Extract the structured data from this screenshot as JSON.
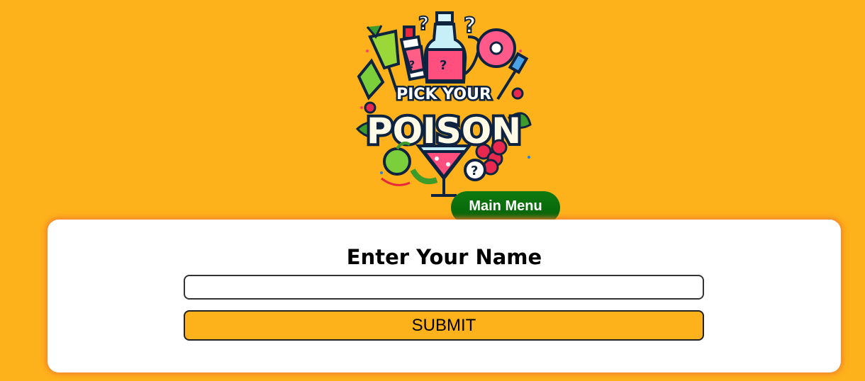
{
  "logo": {
    "line1": "PICK YOUR",
    "line2": "POISON",
    "icon": "pick-your-poison-logo"
  },
  "nav": {
    "main_menu_label": "Main Menu"
  },
  "form": {
    "title": "Enter Your Name",
    "name_value": "",
    "name_placeholder": "",
    "submit_label": "SUBMIT"
  },
  "colors": {
    "background": "#FDB11A",
    "menu_button": "#0A6D0B",
    "card": "#FFFFFF",
    "card_glow": "#F27C2E"
  }
}
